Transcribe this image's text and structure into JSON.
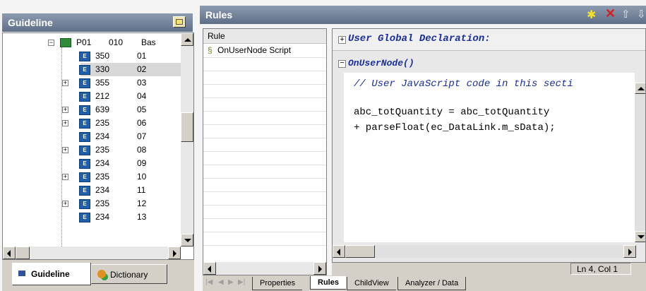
{
  "left_panel": {
    "title": "Guideline",
    "columns": {
      "c2": "010",
      "c3": "Bas"
    },
    "root": {
      "label": "P01",
      "col2": "010",
      "col3": "Bas"
    },
    "rows": [
      {
        "a": "350",
        "b": "01",
        "expandable": false,
        "selected": false
      },
      {
        "a": "330",
        "b": "02",
        "expandable": false,
        "selected": true
      },
      {
        "a": "355",
        "b": "03",
        "expandable": true,
        "selected": false
      },
      {
        "a": "212",
        "b": "04",
        "expandable": false,
        "selected": false
      },
      {
        "a": "639",
        "b": "05",
        "expandable": true,
        "selected": false
      },
      {
        "a": "235",
        "b": "06",
        "expandable": true,
        "selected": false
      },
      {
        "a": "234",
        "b": "07",
        "expandable": false,
        "selected": false
      },
      {
        "a": "235",
        "b": "08",
        "expandable": true,
        "selected": false
      },
      {
        "a": "234",
        "b": "09",
        "expandable": false,
        "selected": false
      },
      {
        "a": "235",
        "b": "10",
        "expandable": true,
        "selected": false
      },
      {
        "a": "234",
        "b": "11",
        "expandable": false,
        "selected": false
      },
      {
        "a": "235",
        "b": "12",
        "expandable": true,
        "selected": false
      },
      {
        "a": "234",
        "b": "13",
        "expandable": false,
        "selected": false
      }
    ],
    "tabs": [
      {
        "label": "Guideline",
        "icon": "guideline-icon",
        "active": true
      },
      {
        "label": "Dictionary",
        "icon": "dictionary-icon",
        "active": false
      }
    ]
  },
  "right_panel": {
    "title": "Rules",
    "toolbar_icons": [
      "add-rule-icon",
      "delete-icon",
      "move-up-icon",
      "move-down-icon"
    ],
    "rule_list": {
      "header": "Rule",
      "items": [
        {
          "label": "OnUserNode Script",
          "icon": "script-icon"
        }
      ]
    },
    "editor": {
      "global_section": "User Global Declaration:",
      "function_section": "OnUserNode()",
      "code_comment": "// User JavaScript code in this secti",
      "code_line1": "abc_totQuantity = abc_totQuantity",
      "code_line2": "+ parseFloat(ec_DataLink.m_sData);",
      "status": "Ln 4, Col 1"
    },
    "bottom_tabs": [
      "Properties",
      "Rules",
      "ChildView",
      "Analyzer / Data"
    ],
    "active_tab": "Rules"
  },
  "colors": {
    "title_bar": "#6b7a94",
    "selected_row": "#d8d8d8",
    "code_keyword": "#1a2f9c",
    "code_comment": "#1a2f9c",
    "code_operator": "#c00000"
  }
}
